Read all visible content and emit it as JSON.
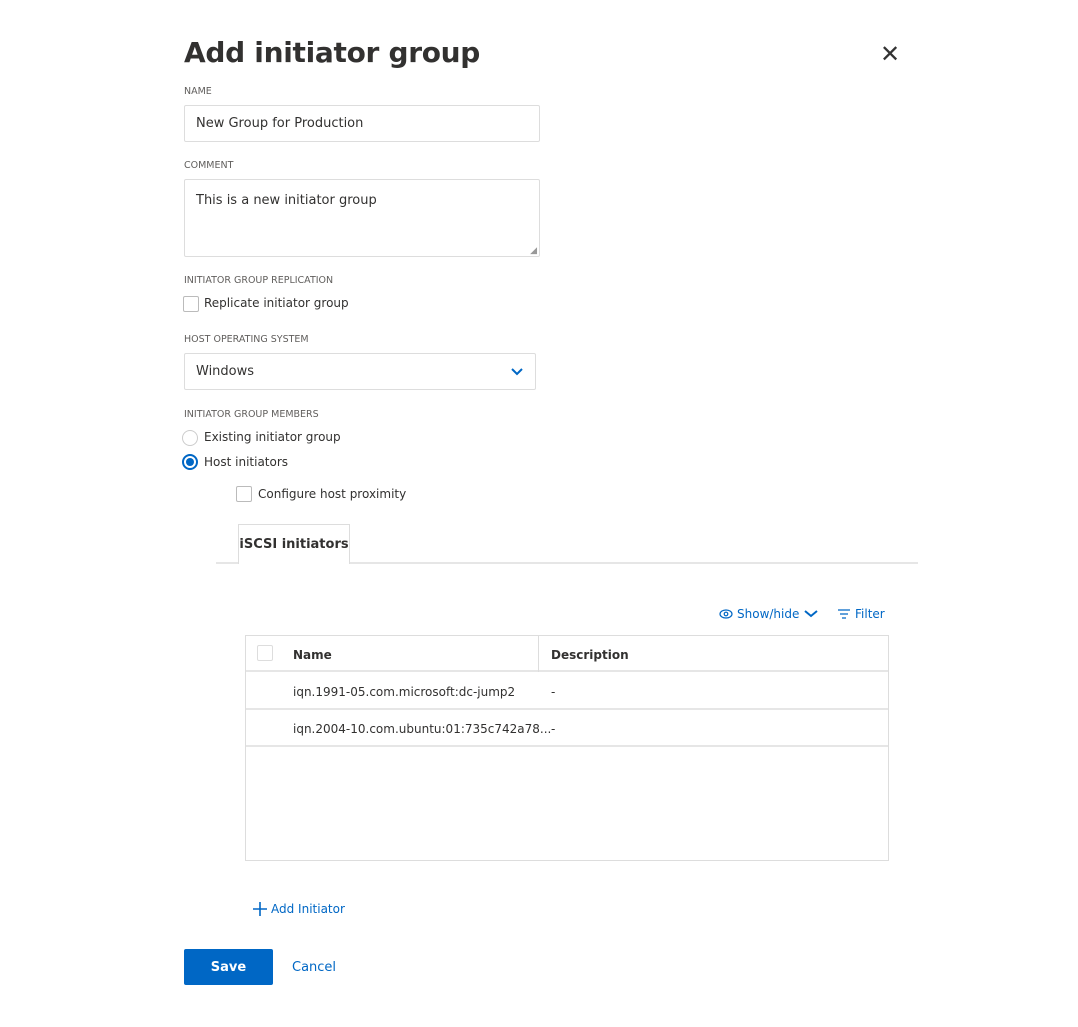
{
  "dialog": {
    "title": "Add initiator group",
    "close_icon": "close-icon"
  },
  "name": {
    "label": "NAME",
    "value": "New Group for Production"
  },
  "comment": {
    "label": "COMMENT",
    "value": "This is a new initiator group"
  },
  "replication": {
    "label": "INITIATOR GROUP REPLICATION",
    "checkbox_label": "Replicate initiator group",
    "checked": false
  },
  "host_os": {
    "label": "HOST OPERATING SYSTEM",
    "selected": "Windows"
  },
  "members": {
    "label": "INITIATOR GROUP MEMBERS",
    "options": [
      "Existing initiator group",
      "Host initiators"
    ],
    "selected": "Host initiators",
    "proximity_label": "Configure host proximity"
  },
  "tabs": [
    {
      "label": "iSCSI initiators",
      "active": true
    }
  ],
  "table_toolbar": {
    "show_hide": "Show/hide",
    "filter": "Filter"
  },
  "table": {
    "columns": [
      "Name",
      "Description"
    ],
    "rows": [
      {
        "name": "iqn.1991-05.com.microsoft:dc-jump2",
        "description": "-"
      },
      {
        "name": "iqn.2004-10.com.ubuntu:01:735c742a78...",
        "description": "-"
      }
    ]
  },
  "add_initiator": "Add Initiator",
  "footer": {
    "save": "Save",
    "cancel": "Cancel"
  },
  "colors": {
    "accent": "#0067c5"
  }
}
